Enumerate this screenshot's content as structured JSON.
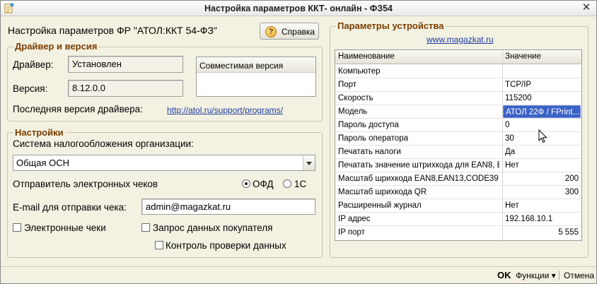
{
  "window": {
    "title": "Настройка параметров ККТ- онлайн - ФЗ54",
    "close_glyph": "✕"
  },
  "header": {
    "title": "Настройка параметров ФР \"АТОЛ:ККТ 54-ФЗ\"",
    "help_button": "Справка",
    "help_icon_glyph": "?"
  },
  "driver_group": {
    "title": "Драйвер и версия",
    "driver_label": "Драйвер:",
    "driver_value": "Установлен",
    "version_label": "Версия:",
    "version_value": "8.12.0.0",
    "compat_header": "Совместимая версия",
    "latest_label": "Последняя версия драйвера:",
    "latest_link": "http://atol.ru/support/programs/"
  },
  "settings_group": {
    "title": "Настройки",
    "tax_label": "Система налогообложения организации:",
    "tax_value": "Общая ОСН",
    "sender_label": "Отправитель электронных чеков",
    "sender_options": [
      {
        "label": "ОФД",
        "checked": true
      },
      {
        "label": "1С",
        "checked": false
      }
    ],
    "email_label": "E-mail для отправки чека:",
    "email_value": "admin@magazkat.ru",
    "check_electronic": "Электронные чеки",
    "check_buyer": "Запрос данных покупателя",
    "check_control": "Контроль проверки данных"
  },
  "device_group": {
    "title": "Параметры устройства",
    "link": "www.magazkat.ru",
    "columns": [
      "Наименование",
      "Значение"
    ],
    "rows": [
      {
        "name": "Компьютер",
        "value": ""
      },
      {
        "name": "Порт",
        "value": "TCP/IP"
      },
      {
        "name": "Скорость",
        "value": "115200"
      },
      {
        "name": "Модель",
        "value": "АТОЛ 22Ф / FPrint..."
      },
      {
        "name": "Пароль доступа",
        "value": "0"
      },
      {
        "name": "Пароль оператора",
        "value": "30"
      },
      {
        "name": "Печатать налоги",
        "value": "Да"
      },
      {
        "name": "Печатать значение штрихкода для EAN8, E...",
        "value": "Нет"
      },
      {
        "name": "Масштаб шрихкода EAN8,EAN13,CODE39",
        "value": "200"
      },
      {
        "name": "Масштаб шрихкода QR",
        "value": "300"
      },
      {
        "name": "Расширенный журнал",
        "value": "Нет"
      },
      {
        "name": "IP адрес",
        "value": "192.168.10.1"
      },
      {
        "name": "IP порт",
        "value": "5 555"
      }
    ]
  },
  "footer": {
    "ok": "OK",
    "functions": "Функции",
    "functions_arrow": "▾",
    "cancel": "Отмена"
  }
}
